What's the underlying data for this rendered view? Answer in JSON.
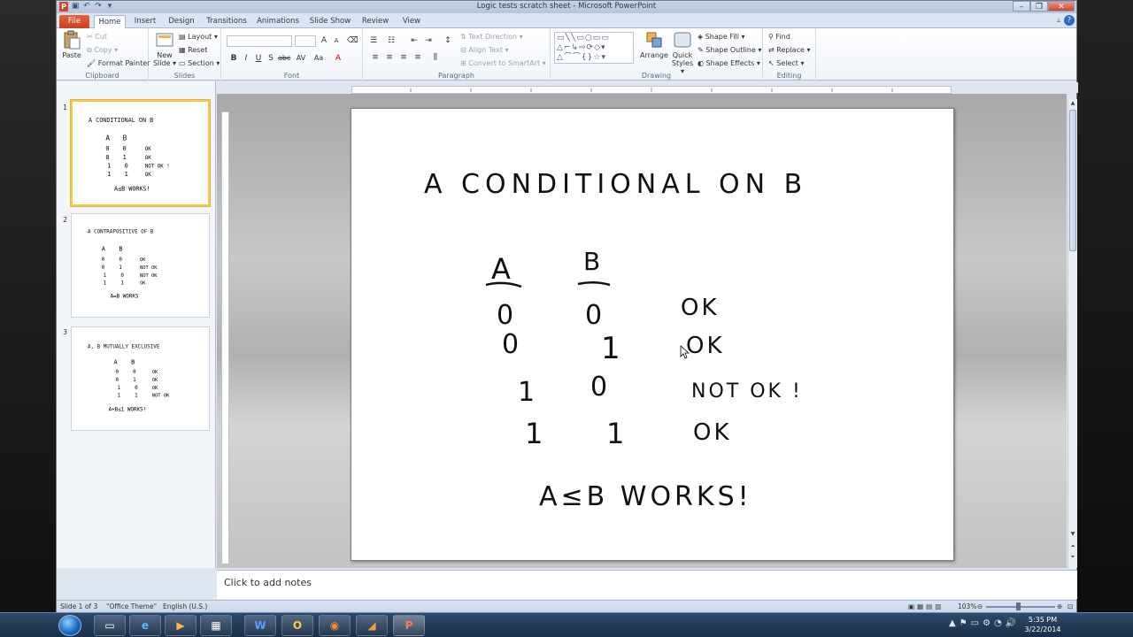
{
  "window": {
    "title": "Logic tests scratch sheet - Microsoft PowerPoint"
  },
  "tabs": [
    {
      "label": "File"
    },
    {
      "label": "Home"
    },
    {
      "label": "Insert"
    },
    {
      "label": "Design"
    },
    {
      "label": "Transitions"
    },
    {
      "label": "Animations"
    },
    {
      "label": "Slide Show"
    },
    {
      "label": "Review"
    },
    {
      "label": "View"
    }
  ],
  "ribbon": {
    "clipboard": {
      "label": "Clipboard",
      "paste": "Paste",
      "cut": "Cut",
      "copy": "Copy",
      "format_painter": "Format Painter"
    },
    "slides": {
      "label": "Slides",
      "new_slide_line1": "New",
      "new_slide_line2": "Slide",
      "layout": "Layout",
      "reset": "Reset",
      "section": "Section"
    },
    "font": {
      "label": "Font"
    },
    "paragraph": {
      "label": "Paragraph",
      "text_direction": "Text Direction",
      "align_text": "Align Text",
      "convert_smartart": "Convert to SmartArt"
    },
    "drawing": {
      "label": "Drawing",
      "arrange": "Arrange",
      "quick_styles_line1": "Quick",
      "quick_styles_line2": "Styles",
      "shape_fill": "Shape Fill",
      "shape_outline": "Shape Outline",
      "shape_effects": "Shape Effects"
    },
    "editing": {
      "label": "Editing",
      "find": "Find",
      "replace": "Replace",
      "select": "Select"
    }
  },
  "slide_panel": {
    "thumbnails": [
      {
        "number": "1",
        "selected": true
      },
      {
        "number": "2",
        "selected": false
      },
      {
        "number": "3",
        "selected": false
      }
    ]
  },
  "slide": {
    "title": "A CONDITIONAL ON B",
    "col_a": "A",
    "col_b": "B",
    "rows": [
      {
        "a": "0",
        "b": "0",
        "result": "OK"
      },
      {
        "a": "0",
        "b": "1",
        "result": "OK"
      },
      {
        "a": "1",
        "b": "0",
        "result": "NOT OK !"
      },
      {
        "a": "1",
        "b": "1",
        "result": "OK"
      }
    ],
    "conclusion": "A≤B WORKS!"
  },
  "thumb2": {
    "title": "A CONTRAPOSITIVE OF B",
    "rows": [
      {
        "a": "0",
        "b": "0",
        "result": "OK"
      },
      {
        "a": "0",
        "b": "1",
        "result": "NOT OK"
      },
      {
        "a": "1",
        "b": "0",
        "result": "NOT OK"
      },
      {
        "a": "1",
        "b": "1",
        "result": "OK"
      }
    ],
    "conclusion": "A=B WORKS"
  },
  "thumb3": {
    "title": "A, B MUTUALLY EXCLUSIVE",
    "rows": [
      {
        "a": "0",
        "b": "0",
        "result": "OK"
      },
      {
        "a": "0",
        "b": "1",
        "result": "OK"
      },
      {
        "a": "1",
        "b": "0",
        "result": "OK"
      },
      {
        "a": "1",
        "b": "1",
        "result": "NOT OK"
      }
    ],
    "conclusion": "A+B≤1 WORKS!"
  },
  "notes": {
    "placeholder": "Click to add notes"
  },
  "statusbar": {
    "slide_count": "Slide 1 of 3",
    "theme": "\"Office Theme\"",
    "language": "English (U.S.)",
    "zoom": "103%"
  },
  "taskbar": {
    "time": "5:35 PM",
    "date": "3/22/2014"
  },
  "colors": {
    "file_tab": "#d24726",
    "selection_border": "#f6c84c",
    "taskbar": "#1a2f48"
  }
}
